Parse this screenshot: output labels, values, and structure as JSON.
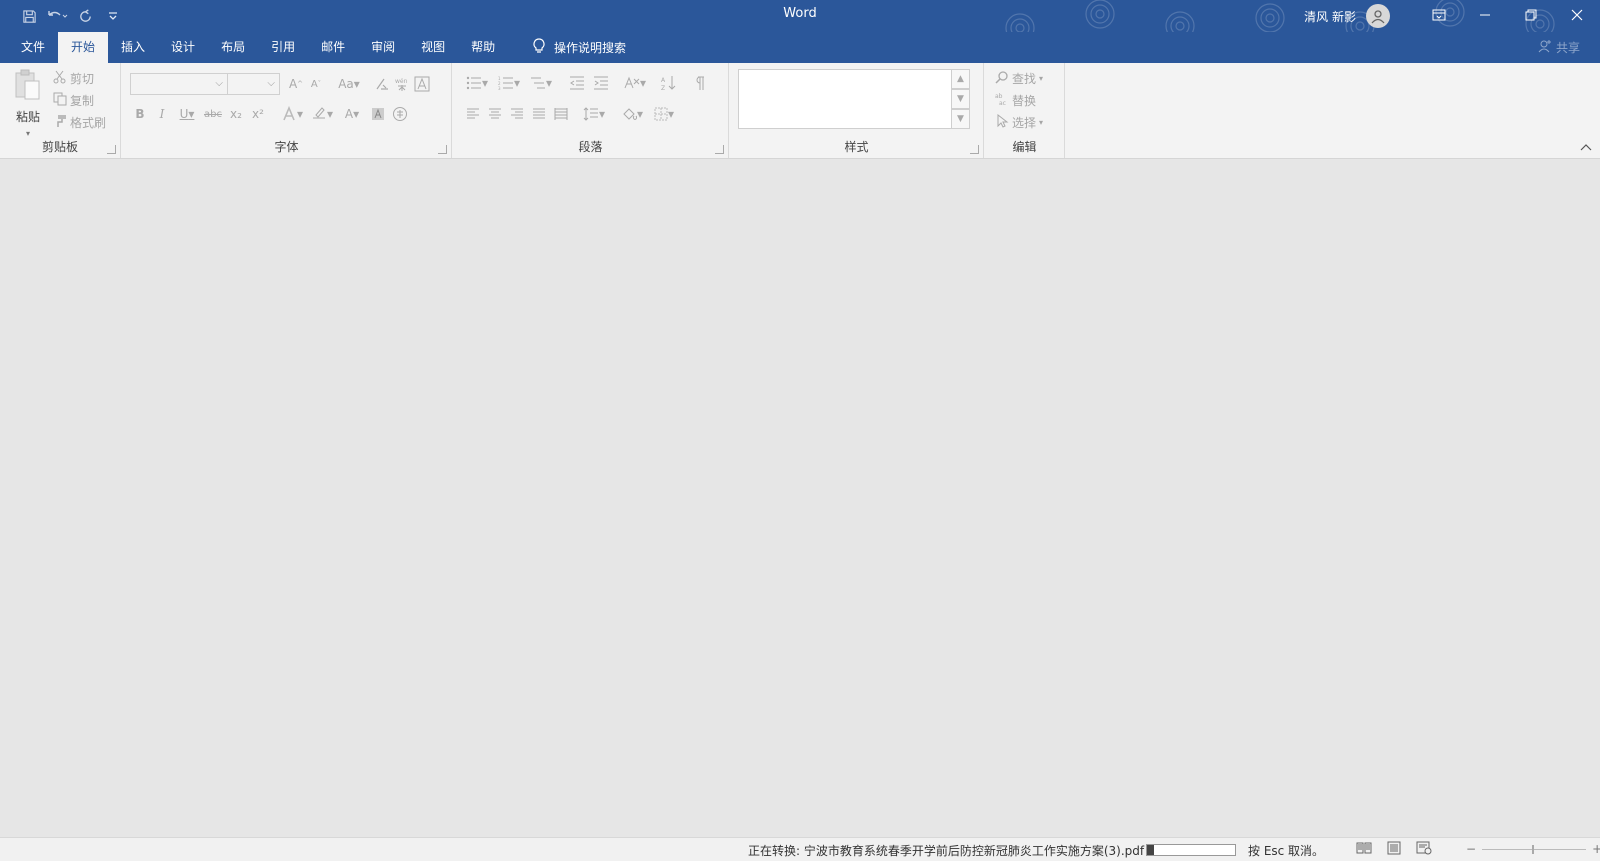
{
  "titlebar": {
    "app_title": "Word",
    "user_name": "清风 新影",
    "qat_icons": [
      "save-icon",
      "undo-icon",
      "redo-icon",
      "customize-qat-icon"
    ],
    "window_controls": [
      "ribbon-display-options-icon",
      "minimize-icon",
      "restore-icon",
      "close-icon"
    ]
  },
  "tabs": [
    {
      "label": "文件",
      "active": false
    },
    {
      "label": "开始",
      "active": true
    },
    {
      "label": "插入",
      "active": false
    },
    {
      "label": "设计",
      "active": false
    },
    {
      "label": "布局",
      "active": false
    },
    {
      "label": "引用",
      "active": false
    },
    {
      "label": "邮件",
      "active": false
    },
    {
      "label": "审阅",
      "active": false
    },
    {
      "label": "视图",
      "active": false
    },
    {
      "label": "帮助",
      "active": false
    }
  ],
  "tellme": {
    "label": "操作说明搜索"
  },
  "share": {
    "label": "共享"
  },
  "ribbon": {
    "clipboard": {
      "label": "剪贴板",
      "paste": "粘贴",
      "cut": "剪切",
      "copy": "复制",
      "format_painter": "格式刷"
    },
    "font": {
      "label": "字体",
      "font_name": "",
      "font_size": "",
      "grow": "A",
      "shrink": "A",
      "change_case": "Aa",
      "bold": "B",
      "italic": "I",
      "underline": "U",
      "strikethrough": "abc",
      "subscript": "x₂",
      "superscript": "x²",
      "font_color": "A"
    },
    "paragraph": {
      "label": "段落"
    },
    "styles": {
      "label": "样式"
    },
    "editing": {
      "label": "编辑",
      "find": "查找",
      "replace": "替换",
      "select": "选择"
    }
  },
  "statusbar": {
    "converting": "正在转换: 宁波市教育系统春季开学前后防控新冠肺炎工作实施方案(3).pdf",
    "progress": 0.08,
    "esc_hint": "按 Esc 取消。"
  }
}
